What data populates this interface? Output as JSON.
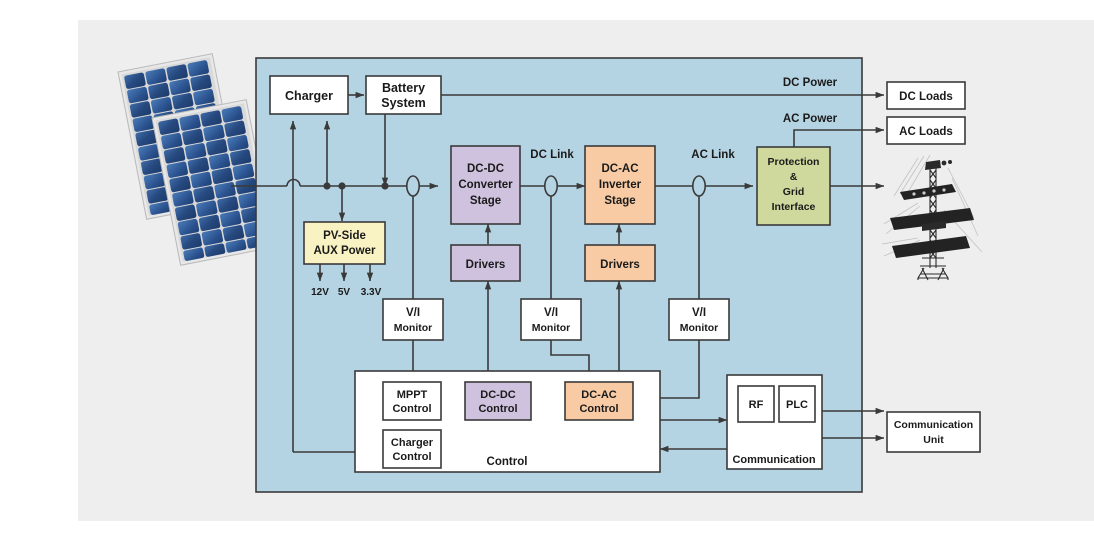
{
  "diagram": {
    "title": "Photovoltaic Power Conversion System Block Diagram",
    "colors": {
      "page_background": "#ffffff",
      "canvas_background": "#eeeeee",
      "system_enclosure": "#b5d4e3",
      "white_block": "#ffffff",
      "purple_block": "#cfc2de",
      "orange_block": "#f8cba4",
      "yellow_block": "#f9f2c2",
      "green_block": "#cfd99e",
      "stroke": "#3a3a3a",
      "text": "#1a1a1a"
    },
    "enclosure": {
      "name": "system-enclosure"
    },
    "blocks": {
      "charger": "Charger",
      "battery_system_line1": "Battery",
      "battery_system_line2": "System",
      "pv_aux_line1": "PV-Side",
      "pv_aux_line2": "AUX Power",
      "dcdc_converter_line1": "DC-DC",
      "dcdc_converter_line2": "Converter",
      "dcdc_converter_line3": "Stage",
      "dcac_inverter_line1": "DC-AC",
      "dcac_inverter_line2": "Inverter",
      "dcac_inverter_line3": "Stage",
      "drivers_dcdc": "Drivers",
      "drivers_dcac": "Drivers",
      "protection_line1": "Protection",
      "protection_line2": "&",
      "protection_line3": "Grid",
      "protection_line4": "Interface",
      "vi_monitor_1_line1": "V/I",
      "vi_monitor_1_line2": "Monitor",
      "vi_monitor_2_line1": "V/I",
      "vi_monitor_2_line2": "Monitor",
      "vi_monitor_3_line1": "V/I",
      "vi_monitor_3_line2": "Monitor",
      "mppt_control_line1": "MPPT",
      "mppt_control_line2": "Control",
      "dcdc_control_line1": "DC-DC",
      "dcdc_control_line2": "Control",
      "dcac_control_line1": "DC-AC",
      "dcac_control_line2": "Control",
      "charger_control_line1": "Charger",
      "charger_control_line2": "Control",
      "control_group": "Control",
      "rf": "RF",
      "plc": "PLC",
      "communication_group": "Communication",
      "dc_loads": "DC Loads",
      "ac_loads": "AC Loads",
      "communication_unit_line1": "Communication",
      "communication_unit_line2": "Unit"
    },
    "wire_labels": {
      "dc_power": "DC Power",
      "ac_power": "AC Power",
      "dc_link": "DC Link",
      "ac_link": "AC Link"
    },
    "voltage_rails": {
      "v12": "12V",
      "v5": "5V",
      "v33": "3.3V"
    },
    "images": {
      "pv_panels": "solar-panel-array-photo",
      "transmission_tower": "electric-transmission-tower-photo"
    }
  }
}
